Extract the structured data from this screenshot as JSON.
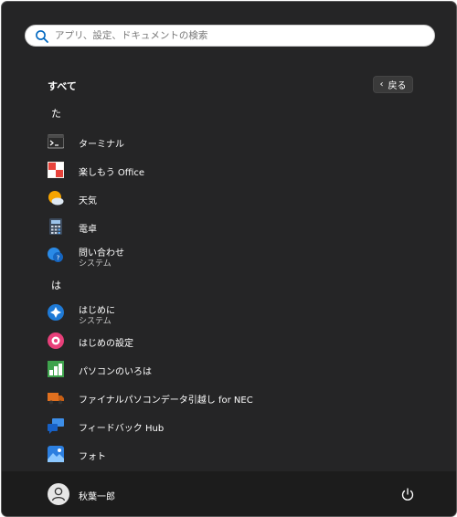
{
  "search": {
    "placeholder": "アプリ、設定、ドキュメントの検索"
  },
  "header": {
    "title": "すべて",
    "back_label": "戻る"
  },
  "groups": [
    {
      "letter": "た",
      "apps": [
        {
          "name": "ターミナル",
          "icon": "terminal-icon"
        },
        {
          "name": "楽しもう Office",
          "icon": "office-icon"
        },
        {
          "name": "天気",
          "icon": "weather-icon"
        },
        {
          "name": "電卓",
          "icon": "calculator-icon"
        },
        {
          "name": "問い合わせ",
          "sub": "システム",
          "icon": "get-help-icon"
        }
      ]
    },
    {
      "letter": "は",
      "apps": [
        {
          "name": "はじめに",
          "sub": "システム",
          "icon": "get-started-icon"
        },
        {
          "name": "はじめの設定",
          "icon": "first-settings-icon"
        },
        {
          "name": "パソコンのいろは",
          "icon": "iroha-icon"
        },
        {
          "name": "ファイナルパソコンデータ引越し for NEC",
          "icon": "data-transfer-truck-icon"
        },
        {
          "name": "フィードバック Hub",
          "icon": "feedback-hub-icon"
        },
        {
          "name": "フォト",
          "icon": "photos-icon"
        }
      ]
    }
  ],
  "footer": {
    "user_name": "秋葉一郎"
  },
  "colors": {
    "panel": "#252526",
    "footer": "#1c1c1c",
    "accent": "#0067c0"
  }
}
